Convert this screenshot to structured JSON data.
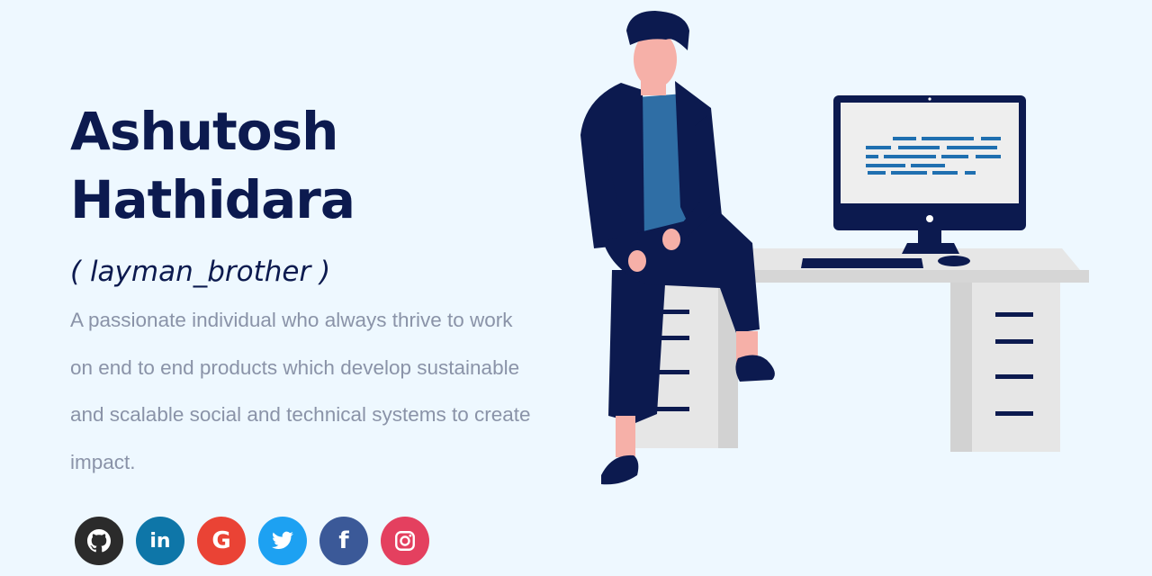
{
  "hero": {
    "name_line1": "Ashutosh",
    "name_line2": "Hathidara",
    "nickname": "( layman_brother )",
    "bio": "A passionate individual who always thrive to work on end to end products which develop sustainable and scalable social and technical systems to create impact."
  },
  "socials": [
    {
      "icon": "github-icon",
      "color": "#2b2b2b"
    },
    {
      "icon": "linkedin-icon",
      "glyph": "in",
      "color": "#0e76a8"
    },
    {
      "icon": "google-icon",
      "glyph": "G",
      "color": "#ea4335"
    },
    {
      "icon": "twitter-icon",
      "color": "#1da1f2"
    },
    {
      "icon": "facebook-icon",
      "glyph": "f",
      "color": "#3b5998"
    },
    {
      "icon": "instagram-icon",
      "color": "#e4405f"
    }
  ]
}
